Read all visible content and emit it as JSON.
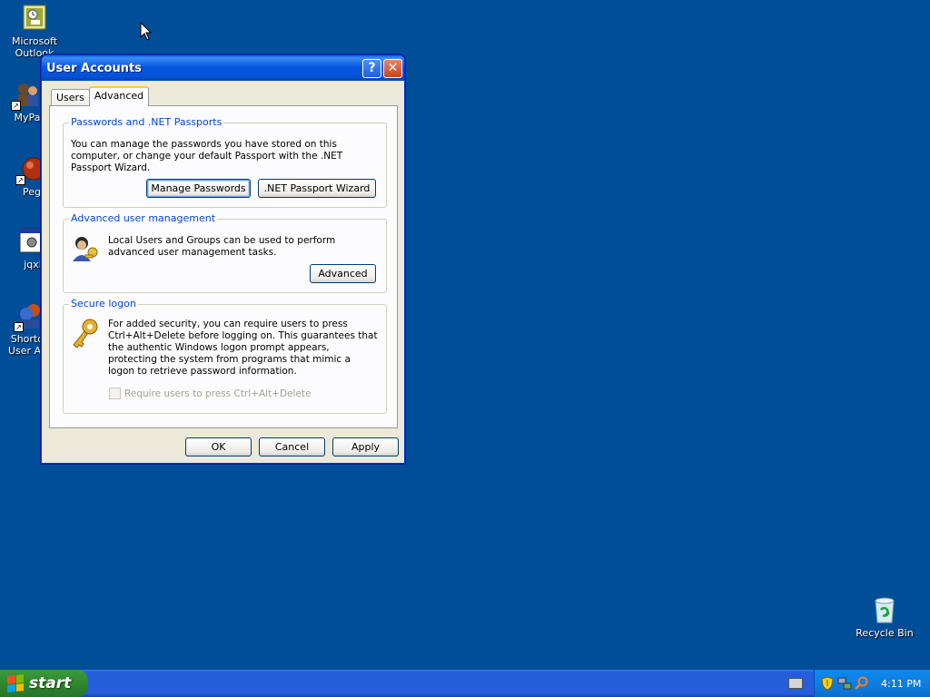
{
  "desktop": {
    "icons": [
      {
        "label_line1": "Microsoft",
        "label_line2": "Outlook"
      },
      {
        "label_line1": "MyPa",
        "label_line2": ""
      },
      {
        "label_line1": "Peg",
        "label_line2": ""
      },
      {
        "label_line1": "jqxl",
        "label_line2": ""
      },
      {
        "label_line1": "Shortcu",
        "label_line2": "User Acc"
      }
    ],
    "recycle_bin": {
      "label": "Recycle Bin"
    }
  },
  "window": {
    "title": "User Accounts",
    "help_glyph": "?",
    "close_glyph": "✕",
    "tabs": [
      {
        "label": "Users",
        "active": false
      },
      {
        "label": "Advanced",
        "active": true
      }
    ],
    "passwords_group": {
      "title": "Passwords and .NET Passports",
      "text": "You can manage the passwords you have stored on this computer, or change your default Passport with the .NET Passport Wizard.",
      "manage_button": "Manage Passwords",
      "wizard_button": ".NET Passport Wizard"
    },
    "advanced_group": {
      "title": "Advanced user management",
      "text": "Local Users and Groups can be used to perform advanced user management tasks.",
      "button": "Advanced"
    },
    "secure_group": {
      "title": "Secure logon",
      "text": "For added security, you can require users to press Ctrl+Alt+Delete before logging on. This guarantees that the authentic Windows logon prompt appears, protecting the system from programs that mimic a logon to retrieve password information.",
      "checkbox_label": "Require users to press Ctrl+Alt+Delete",
      "checkbox_checked": false,
      "checkbox_enabled": false
    },
    "ok_button": "OK",
    "cancel_button": "Cancel",
    "apply_button": "Apply"
  },
  "taskbar": {
    "start_label": "start",
    "clock": "4:11 PM"
  },
  "colors": {
    "desktop": "#004e98",
    "group_title": "#0046d5",
    "titlebar": "#0857e1"
  }
}
